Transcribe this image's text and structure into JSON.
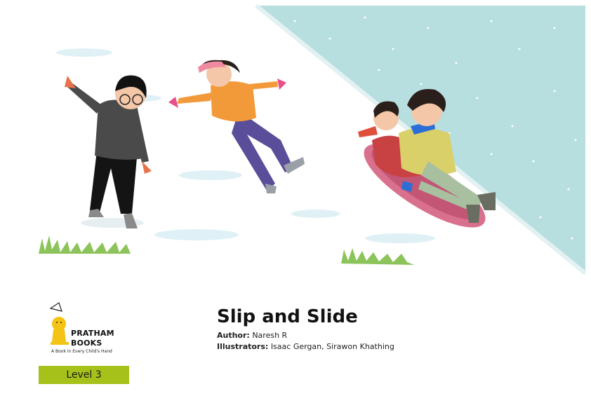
{
  "book": {
    "title": "Slip and Slide",
    "author_label": "Author:",
    "author": "Naresh R",
    "illustrators_label": "Illustrators:",
    "illustrators": "Isaac Gergan, Sirawon Khathing",
    "level": "Level 3"
  },
  "publisher": {
    "name_line1": "PRATHAM",
    "name_line2": "BOOKS",
    "tagline": "A Book in Every Child's Hand"
  },
  "colors": {
    "sky": "#b7dfe0",
    "snow": "#ffffff",
    "level_badge": "#a6c21a",
    "logo_yellow": "#f4c414"
  }
}
